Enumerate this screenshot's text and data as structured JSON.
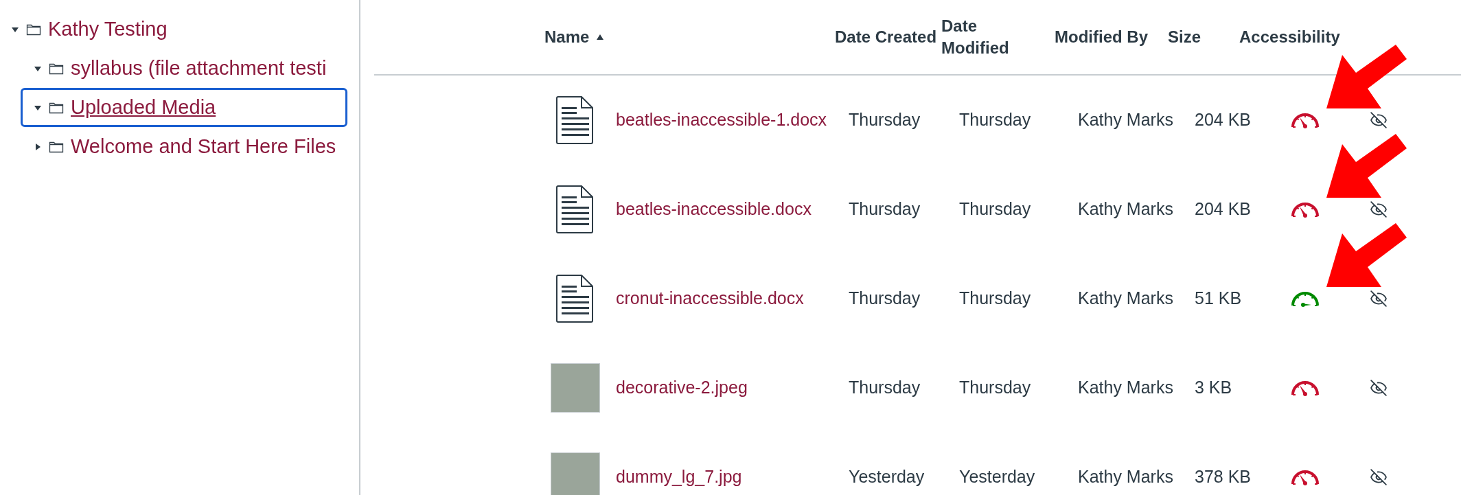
{
  "tree": [
    {
      "label": "Kathy Testing",
      "expanded": true,
      "selected": false,
      "children": [
        {
          "label": "syllabus (file attachment testi",
          "expanded": true,
          "selected": false
        },
        {
          "label": "Uploaded Media",
          "expanded": true,
          "selected": true
        },
        {
          "label": "Welcome and Start Here Files",
          "expanded": false,
          "selected": false
        }
      ]
    }
  ],
  "table": {
    "columns": [
      {
        "label": "Name",
        "sorted": true
      },
      {
        "label": "Date Created",
        "sorted": false
      },
      {
        "label": "Date Modified",
        "sorted": false
      },
      {
        "label": "Modified By",
        "sorted": false
      },
      {
        "label": "Size",
        "sorted": false
      },
      {
        "label": "Accessibility",
        "sorted": false
      }
    ],
    "rows": [
      {
        "kind": "document",
        "name": "beatles-inaccessible-1.docx",
        "created": "Thursday",
        "modified": "Thursday",
        "modified_by": "Kathy Marks",
        "size": "204 KB",
        "color": "#c8102e",
        "flagged": true
      },
      {
        "kind": "document",
        "name": "beatles-inaccessible.docx",
        "created": "Thursday",
        "modified": "Thursday",
        "modified_by": "Kathy Marks",
        "size": "204 KB",
        "color": "#c8102e",
        "flagged": true
      },
      {
        "kind": "document",
        "name": "cronut-inaccessible.docx",
        "created": "Thursday",
        "modified": "Thursday",
        "modified_by": "Kathy Marks",
        "size": "51 KB",
        "color": "#008a00",
        "flagged": true
      },
      {
        "kind": "image",
        "name": "decorative-2.jpeg",
        "created": "Thursday",
        "modified": "Thursday",
        "modified_by": "Kathy Marks",
        "size": "3 KB",
        "color": "#c8102e",
        "flagged": false
      },
      {
        "kind": "image",
        "name": "dummy_lg_7.jpg",
        "created": "Yesterday",
        "modified": "Yesterday",
        "modified_by": "Kathy Marks",
        "size": "378 KB",
        "color": "#c8102e",
        "flagged": false
      }
    ]
  }
}
